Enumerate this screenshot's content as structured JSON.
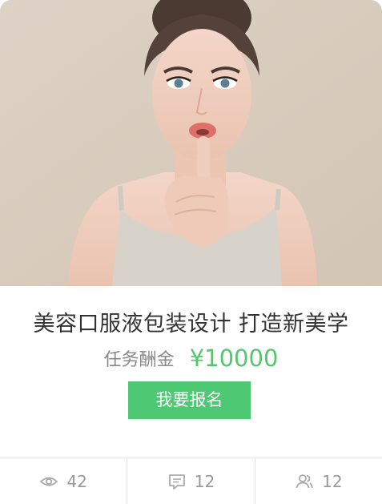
{
  "task": {
    "title": "美容口服液包装设计 打造新美学",
    "fee_label": "任务酬金",
    "fee_value": "¥10000",
    "signup_label": "我要报名"
  },
  "stats": {
    "views": "42",
    "comments": "12",
    "participants": "12"
  },
  "icons": [
    "eye-icon",
    "comment-icon",
    "users-icon"
  ],
  "colors": {
    "accent": "#4ec872",
    "price": "#55c56e",
    "photo_background": "#d9cdbf"
  }
}
